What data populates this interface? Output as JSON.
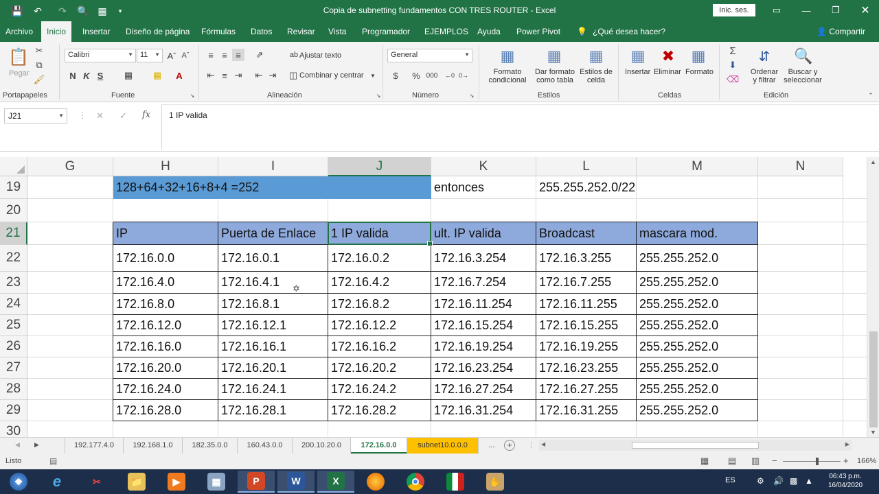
{
  "window": {
    "title": "Copia de subnetting fundamentos CON TRES ROUTER  -  Excel",
    "signin_label": "Inic. ses."
  },
  "ribbon_tabs": [
    "Archivo",
    "Inicio",
    "Insertar",
    "Diseño de página",
    "Fórmulas",
    "Datos",
    "Revisar",
    "Vista",
    "Programador",
    "EJEMPLOS",
    "Ayuda",
    "Power Pivot",
    "¿Qué desea hacer?"
  ],
  "share_label": "Compartir",
  "ribbon": {
    "paste_label": "Pegar",
    "font_name": "Calibri",
    "font_size": "11",
    "bold": "N",
    "italic": "K",
    "underline": "S",
    "wrap_text": "Ajustar texto",
    "merge_center": "Combinar y centrar",
    "number_format": "General",
    "currency": "$",
    "percent": "%",
    "thousands": "000",
    "cond_format": [
      "Formato",
      "condicional"
    ],
    "format_table": [
      "Dar formato",
      "como tabla"
    ],
    "cell_styles": [
      "Estilos de",
      "celda"
    ],
    "insert": "Insertar",
    "delete": "Eliminar",
    "format": "Formato",
    "sort_filter": [
      "Ordenar",
      "y filtrar"
    ],
    "find_select": [
      "Buscar y",
      "seleccionar"
    ],
    "groups": [
      "Portapapeles",
      "Fuente",
      "Alineación",
      "Número",
      "Estilos",
      "Celdas",
      "Edición"
    ]
  },
  "formula_bar": {
    "name_box": "J21",
    "fx": "fx",
    "content": "1 IP valida"
  },
  "columns": [
    "G",
    "H",
    "I",
    "J",
    "K",
    "L",
    "M",
    "N"
  ],
  "rows": [
    "19",
    "20",
    "21",
    "22",
    "23",
    "24",
    "25",
    "26",
    "27",
    "28",
    "29",
    "30"
  ],
  "row19": {
    "banner": "128+64+32+16+8+4 =252",
    "then": "entonces",
    "result": "255.255.252.0/22"
  },
  "table": {
    "headers": [
      "IP",
      "Puerta de Enlace",
      "1 IP valida",
      "ult. IP valida",
      "Broadcast",
      "mascara mod."
    ],
    "rows": [
      [
        "172.16.0.0",
        "172.16.0.1",
        "172.16.0.2",
        "172.16.3.254",
        "172.16.3.255",
        "255.255.252.0"
      ],
      [
        "172.16.4.0",
        "172.16.4.1",
        "172.16.4.2",
        "172.16.7.254",
        "172.16.7.255",
        "255.255.252.0"
      ],
      [
        "172.16.8.0",
        "172.16.8.1",
        "172.16.8.2",
        "172.16.11.254",
        "172.16.11.255",
        "255.255.252.0"
      ],
      [
        "172.16.12.0",
        "172.16.12.1",
        "172.16.12.2",
        "172.16.15.254",
        "172.16.15.255",
        "255.255.252.0"
      ],
      [
        "172.16.16.0",
        "172.16.16.1",
        "172.16.16.2",
        "172.16.19.254",
        "172.16.19.255",
        "255.255.252.0"
      ],
      [
        "172.16.20.0",
        "172.16.20.1",
        "172.16.20.2",
        "172.16.23.254",
        "172.16.23.255",
        "255.255.252.0"
      ],
      [
        "172.16.24.0",
        "172.16.24.1",
        "172.16.24.2",
        "172.16.27.254",
        "172.16.27.255",
        "255.255.252.0"
      ],
      [
        "172.16.28.0",
        "172.16.28.1",
        "172.16.28.2",
        "172.16.31.254",
        "172.16.31.255",
        "255.255.252.0"
      ]
    ]
  },
  "sheets": [
    "192.177.4.0",
    "192.168.1.0",
    "182.35.0.0",
    "160.43.0.0",
    "200.10.20.0",
    "172.16.0.0",
    "subnet10.0.0.0",
    "..."
  ],
  "active_sheet": "172.16.0.0",
  "status": {
    "ready": "Listo",
    "zoom": "166%"
  },
  "taskbar": {
    "lang": "ES",
    "time": "06:43 p.m.",
    "date": "16/04/2020"
  },
  "colors": {
    "excel_green": "#217346",
    "header_fill": "#8ea9db",
    "banner_fill": "#5b9bd5",
    "active_tab_fill": "#ffc000"
  }
}
